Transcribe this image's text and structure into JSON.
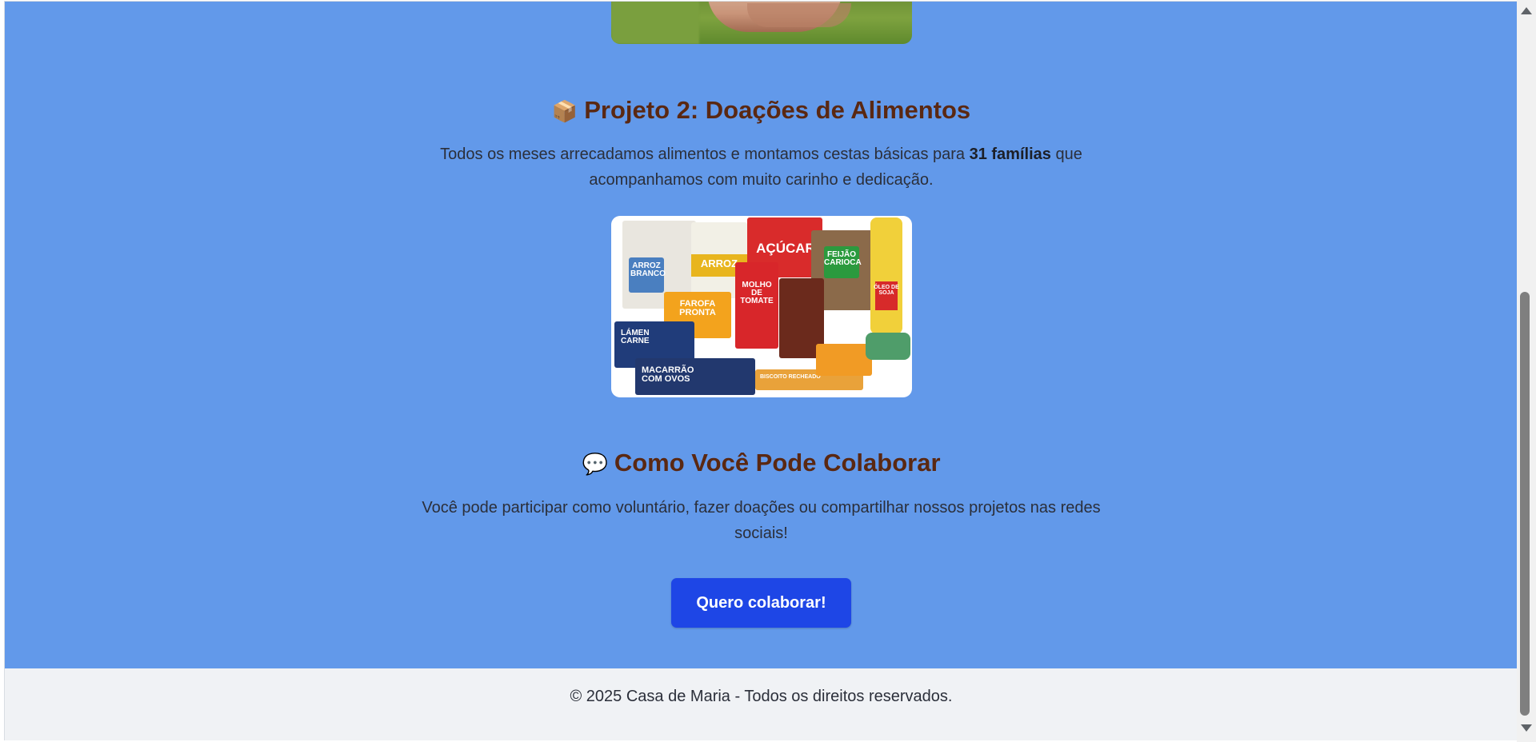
{
  "project2": {
    "emoji": "📦",
    "title": "Projeto 2: Doações de Alimentos",
    "desc_before": "Todos os meses arrecadamos alimentos e montamos cestas básicas para ",
    "desc_bold": "31 famílias",
    "desc_after": " que acompanhamos com muito carinho e dedicação.",
    "image_labels": {
      "arroz_branco": "ARROZ BRANCO",
      "arroz": "ARROZ",
      "acucar": "AÇÚCAR",
      "feijao": "FEIJÃO CARIOCA",
      "oleo": "ÓLEO DE SOJA",
      "farofa": "FAROFA PRONTA",
      "molho": "MOLHO DE TOMATE",
      "lamen": "LÁMEN CARNE",
      "macarrao": "MACARRÃO COM OVOS",
      "biscoito": "BISCOITO RECHEADO"
    }
  },
  "collaborate": {
    "emoji": "💬",
    "title": "Como Você Pode Colaborar",
    "desc": "Você pode participar como voluntário, fazer doações ou compartilhar nossos projetos nas redes sociais!",
    "button_label": "Quero colaborar!"
  },
  "footer": {
    "text": "© 2025 Casa de Maria - Todos os direitos reservados."
  },
  "colors": {
    "page_bg": "#6299ea",
    "heading": "#5a2812",
    "button": "#1e46e6",
    "footer_bg": "#f0f2f5"
  }
}
